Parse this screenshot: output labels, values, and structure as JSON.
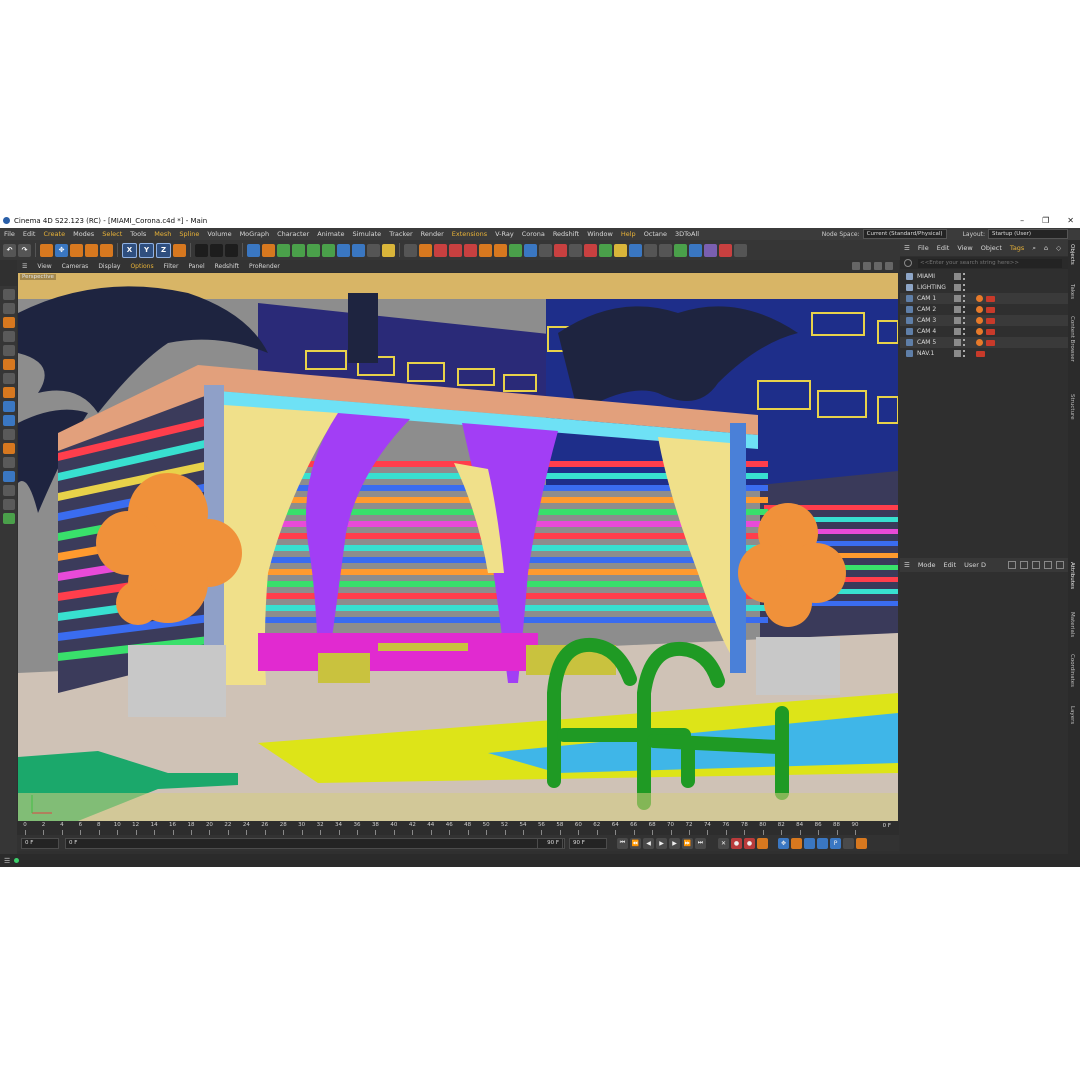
{
  "window": {
    "title": "Cinema 4D S22.123 (RC) - [MIAMI_Corona.c4d *] - Main",
    "minimize": "–",
    "maximize": "❐",
    "close": "✕"
  },
  "menu": {
    "items": [
      {
        "label": "File"
      },
      {
        "label": "Edit"
      },
      {
        "label": "Create"
      },
      {
        "label": "Modes"
      },
      {
        "label": "Select"
      },
      {
        "label": "Tools"
      },
      {
        "label": "Mesh"
      },
      {
        "label": "Spline"
      },
      {
        "label": "Volume"
      },
      {
        "label": "MoGraph"
      },
      {
        "label": "Character"
      },
      {
        "label": "Animate"
      },
      {
        "label": "Simulate"
      },
      {
        "label": "Tracker"
      },
      {
        "label": "Render"
      },
      {
        "label": "Extensions"
      },
      {
        "label": "V-Ray"
      },
      {
        "label": "Corona"
      },
      {
        "label": "Redshift"
      },
      {
        "label": "Window"
      },
      {
        "label": "Help"
      },
      {
        "label": "Octane"
      },
      {
        "label": "3DToAll"
      }
    ],
    "node_space_label": "Node Space:",
    "node_space_value": "Current (Standard/Physical)",
    "layout_label": "Layout:",
    "layout_value": "Startup (User)"
  },
  "toolbar": {
    "axis_x": "X",
    "axis_y": "Y",
    "axis_z": "Z"
  },
  "viewport": {
    "menu": [
      "View",
      "Cameras",
      "Display",
      "Options",
      "Filter",
      "Panel",
      "Redshift",
      "ProRender"
    ],
    "label": "Perspective"
  },
  "timeline": {
    "ticks": [
      "0",
      "2",
      "4",
      "6",
      "8",
      "10",
      "12",
      "14",
      "16",
      "18",
      "20",
      "22",
      "24",
      "26",
      "28",
      "30",
      "32",
      "34",
      "36",
      "38",
      "40",
      "42",
      "44",
      "46",
      "48",
      "50",
      "52",
      "54",
      "56",
      "58",
      "60",
      "62",
      "64",
      "66",
      "68",
      "70",
      "72",
      "74",
      "76",
      "78",
      "80",
      "82",
      "84",
      "86",
      "88",
      "90"
    ],
    "current_frame": "0 F",
    "start": "0 F",
    "min": "0 F",
    "max": "90 F",
    "end": "90 F"
  },
  "objects_panel": {
    "menu": [
      "File",
      "Edit",
      "View",
      "Object",
      "Tags"
    ],
    "search_placeholder": "<<Enter your search string here>>",
    "items": [
      {
        "name": "MIAMI",
        "kind": "null"
      },
      {
        "name": "LIGHTING",
        "kind": "null"
      },
      {
        "name": "CAM 1",
        "kind": "cam"
      },
      {
        "name": "CAM 2",
        "kind": "cam"
      },
      {
        "name": "CAM 3",
        "kind": "cam"
      },
      {
        "name": "CAM 4",
        "kind": "cam"
      },
      {
        "name": "CAM 5",
        "kind": "cam"
      },
      {
        "name": "NAV.1",
        "kind": "cam"
      }
    ]
  },
  "attributes_panel": {
    "menu": [
      "Mode",
      "Edit",
      "User D"
    ]
  },
  "side_tabs": {
    "top": [
      "Objects",
      "Takes",
      "Content Browser",
      "Structure"
    ],
    "bottom": [
      "Attributes",
      "Materials",
      "Coordinates",
      "Layers"
    ]
  },
  "colors": {
    "accent": "#e9b338",
    "panel": "#303030",
    "sky": "#2b2a6f",
    "pool": "#3fb6e8",
    "ladder": "#1f9a24",
    "curtain_yellow": "#f0e08a",
    "curtain_purple": "#a23ef5",
    "tree": "#f0913a",
    "deck": "#cfc2b6"
  }
}
